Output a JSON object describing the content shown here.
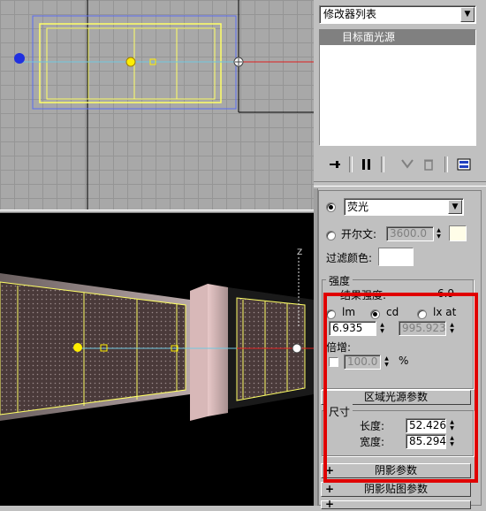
{
  "modifier_list": {
    "label": "修改器列表",
    "stack_item": "目标面光源"
  },
  "distribution": {
    "selected": "荧光"
  },
  "color": {
    "kelvin_label": "开尔文:",
    "kelvin_value": "3600.0",
    "filter_label": "过滤颜色:",
    "filter_color": "#ffffff",
    "kelvin_color": "#fffde8"
  },
  "intensity": {
    "header": "强度",
    "result_label": "结果强度:",
    "result_value": "6.9",
    "units": [
      "lm",
      "cd",
      "lx at"
    ],
    "selected_unit": "cd",
    "value": "6.935",
    "lx_value": "995.923",
    "multiplier_label": "倍增:",
    "multiplier_value": "100.0",
    "percent": "%"
  },
  "area_light": {
    "rollout": "区域光源参数",
    "size_header": "尺寸",
    "length_label": "长度:",
    "length_value": "52.426",
    "width_label": "宽度:",
    "width_value": "85.294"
  },
  "shadow_params": "阴影参数",
  "shadow_map_params": "阴影贴图参数",
  "rollout_plus": "+",
  "colors": {
    "highlight": "#e00000",
    "selection": "#ffff00",
    "panel": "#c0c0c0"
  }
}
